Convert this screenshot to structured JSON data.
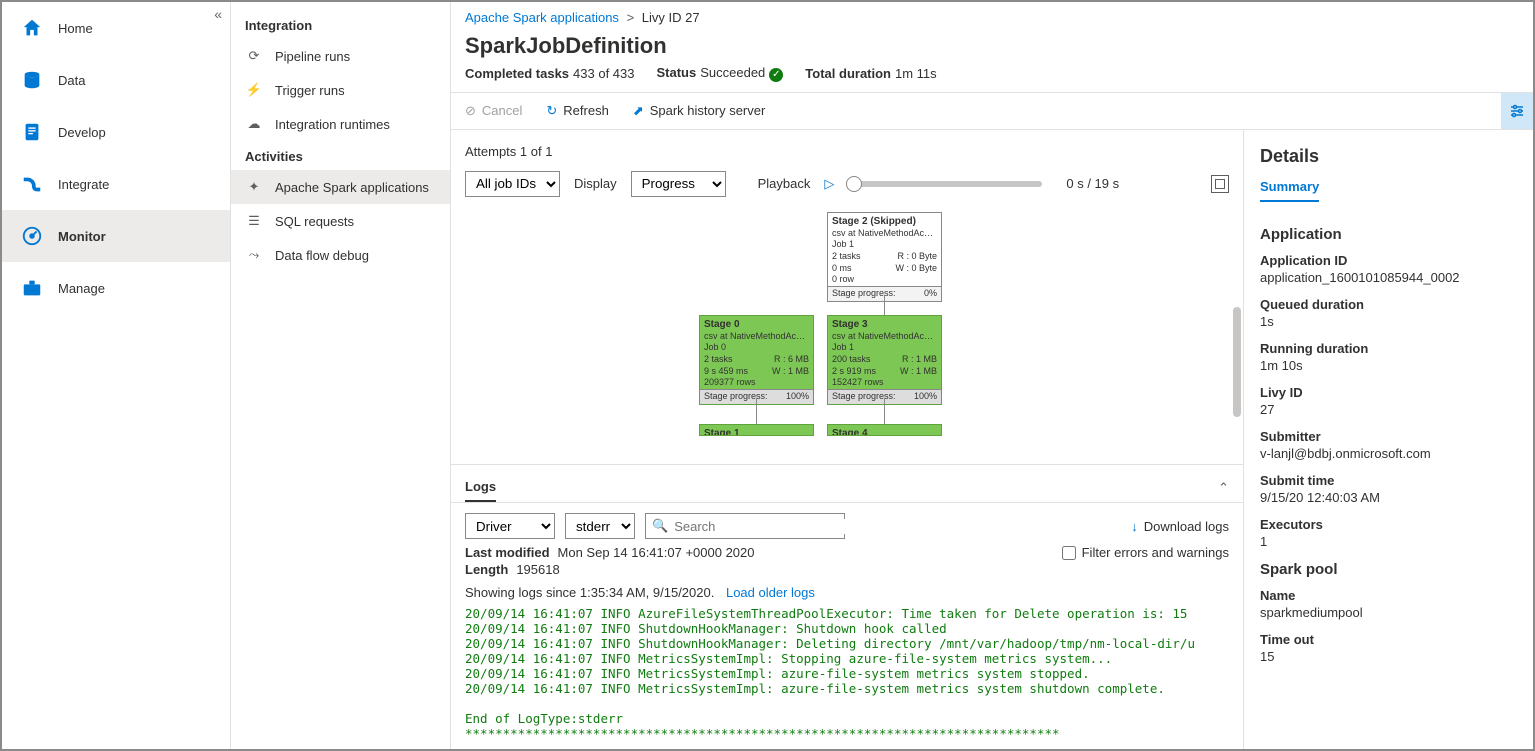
{
  "leftnav": {
    "items": [
      {
        "label": "Home"
      },
      {
        "label": "Data"
      },
      {
        "label": "Develop"
      },
      {
        "label": "Integrate"
      },
      {
        "label": "Monitor"
      },
      {
        "label": "Manage"
      }
    ]
  },
  "subnav": {
    "groups": [
      {
        "heading": "Integration",
        "items": [
          {
            "label": "Pipeline runs"
          },
          {
            "label": "Trigger runs"
          },
          {
            "label": "Integration runtimes"
          }
        ]
      },
      {
        "heading": "Activities",
        "items": [
          {
            "label": "Apache Spark applications"
          },
          {
            "label": "SQL requests"
          },
          {
            "label": "Data flow debug"
          }
        ]
      }
    ]
  },
  "breadcrumb": {
    "parent": "Apache Spark applications",
    "sep": ">",
    "current": "Livy ID 27"
  },
  "title": "SparkJobDefinition",
  "statusrow": {
    "tasks_label": "Completed tasks",
    "tasks_val": "433 of 433",
    "status_label": "Status",
    "status_val": "Succeeded",
    "duration_label": "Total duration",
    "duration_val": "1m 11s"
  },
  "toolbar": {
    "cancel": "Cancel",
    "refresh": "Refresh",
    "history": "Spark history server"
  },
  "attempts": "Attempts 1 of 1",
  "controls": {
    "jobids": "All job IDs",
    "display_label": "Display",
    "display_value": "Progress",
    "playback_label": "Playback",
    "time": "0 s  /  19 s"
  },
  "stages": {
    "s2": {
      "title": "Stage 2 (Skipped)",
      "desc": "csv at NativeMethodAccessor...",
      "job": "Job 1",
      "tasks": "2 tasks",
      "r": "R : 0 Byte",
      "t": "0 ms",
      "w": "W : 0 Byte",
      "rows": "0 row",
      "prog": "Stage progress:",
      "pct": "0%"
    },
    "s0": {
      "title": "Stage 0",
      "desc": "csv at NativeMethodAccessor...",
      "job": "Job 0",
      "tasks": "2 tasks",
      "r": "R : 6 MB",
      "t": "9 s 459 ms",
      "w": "W : 1 MB",
      "rows": "209377 rows",
      "prog": "Stage progress:",
      "pct": "100%"
    },
    "s3": {
      "title": "Stage 3",
      "desc": "csv at NativeMethodAccessor...",
      "job": "Job 1",
      "tasks": "200 tasks",
      "r": "R : 1 MB",
      "t": "2 s 919 ms",
      "w": "W : 1 MB",
      "rows": "152427 rows",
      "prog": "Stage progress:",
      "pct": "100%"
    },
    "s1": {
      "title": "Stage 1"
    },
    "s4": {
      "title": "Stage 4"
    }
  },
  "logs": {
    "tab": "Logs",
    "source": "Driver",
    "stream": "stderr",
    "search_ph": "Search",
    "download": "Download logs",
    "filter_label": "Filter errors and warnings",
    "lastmod_label": "Last modified",
    "lastmod_val": "Mon Sep 14 16:41:07 +0000 2020",
    "length_label": "Length",
    "length_val": "195618",
    "since": "Showing logs since 1:35:34 AM, 9/15/2020.",
    "older": "Load older logs",
    "lines": [
      "20/09/14 16:41:07 INFO AzureFileSystemThreadPoolExecutor: Time taken for Delete operation is: 15",
      "20/09/14 16:41:07 INFO ShutdownHookManager: Shutdown hook called",
      "20/09/14 16:41:07 INFO ShutdownHookManager: Deleting directory /mnt/var/hadoop/tmp/nm-local-dir/u",
      "20/09/14 16:41:07 INFO MetricsSystemImpl: Stopping azure-file-system metrics system...",
      "20/09/14 16:41:07 INFO MetricsSystemImpl: azure-file-system metrics system stopped.",
      "20/09/14 16:41:07 INFO MetricsSystemImpl: azure-file-system metrics system shutdown complete.",
      "",
      "End of LogType:stderr",
      "*******************************************************************************"
    ]
  },
  "details": {
    "title": "Details",
    "tab": "Summary",
    "app_heading": "Application",
    "items": [
      {
        "k": "Application ID",
        "v": "application_1600101085944_0002"
      },
      {
        "k": "Queued duration",
        "v": "1s"
      },
      {
        "k": "Running duration",
        "v": "1m 10s"
      },
      {
        "k": "Livy ID",
        "v": "27"
      },
      {
        "k": "Submitter",
        "v": "v-lanjl@bdbj.onmicrosoft.com"
      },
      {
        "k": "Submit time",
        "v": "9/15/20 12:40:03 AM"
      },
      {
        "k": "Executors",
        "v": "1"
      }
    ],
    "pool_heading": "Spark pool",
    "pool_items": [
      {
        "k": "Name",
        "v": "sparkmediumpool"
      },
      {
        "k": "Time out",
        "v": "15"
      }
    ]
  }
}
